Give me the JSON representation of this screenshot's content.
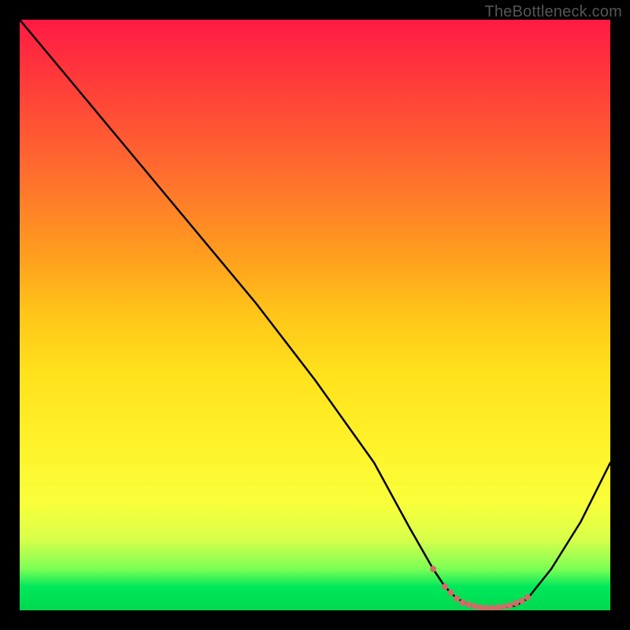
{
  "watermark": "TheBottleneck.com",
  "chart_data": {
    "type": "line",
    "title": "",
    "xlabel": "",
    "ylabel": "",
    "xlim": [
      0,
      100
    ],
    "ylim": [
      0,
      100
    ],
    "series": [
      {
        "name": "curve",
        "x": [
          0,
          5,
          10,
          20,
          30,
          40,
          50,
          60,
          66,
          70,
          72,
          74,
          76,
          78,
          80,
          82,
          84,
          86,
          90,
          95,
          100
        ],
        "y": [
          100,
          94,
          88,
          76,
          64,
          52,
          39,
          25,
          14,
          7,
          4,
          2,
          1,
          0.5,
          0.4,
          0.5,
          0.8,
          2,
          7,
          15,
          25
        ]
      }
    ],
    "markers": {
      "name": "dots",
      "x": [
        70,
        72,
        73,
        74,
        75,
        76,
        77,
        78,
        79,
        80,
        81,
        82,
        83,
        84,
        85,
        86
      ],
      "y": [
        7,
        4,
        3,
        2,
        1.3,
        1,
        0.7,
        0.5,
        0.4,
        0.4,
        0.5,
        0.6,
        0.8,
        1.2,
        1.6,
        2.2
      ]
    },
    "background_gradient": {
      "direction": "vertical",
      "stops": [
        {
          "pos": 0,
          "color": "#ff1a44"
        },
        {
          "pos": 0.25,
          "color": "#ff6a2f"
        },
        {
          "pos": 0.5,
          "color": "#ffc619"
        },
        {
          "pos": 0.75,
          "color": "#fff22a"
        },
        {
          "pos": 0.95,
          "color": "#00e85a"
        },
        {
          "pos": 1.0,
          "color": "#00d84f"
        }
      ]
    }
  }
}
